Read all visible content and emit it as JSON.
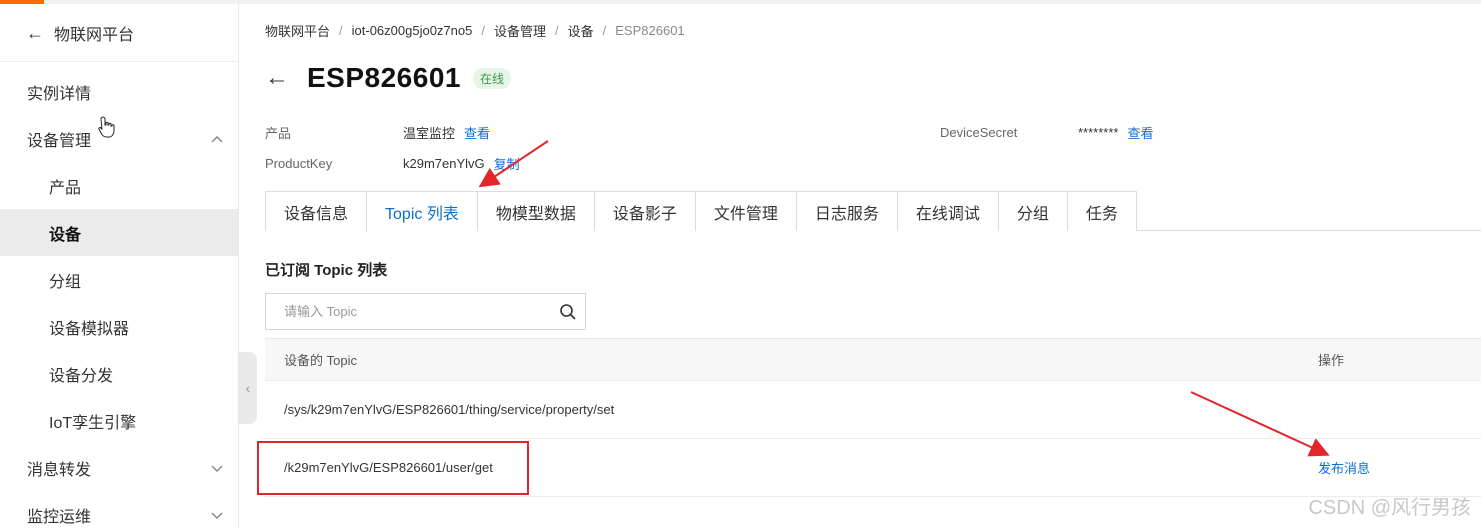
{
  "sidebar": {
    "back_label": "物联网平台",
    "items": [
      {
        "label": "实例详情"
      },
      {
        "label": "设备管理"
      },
      {
        "label": "产品"
      },
      {
        "label": "设备"
      },
      {
        "label": "分组"
      },
      {
        "label": "设备模拟器"
      },
      {
        "label": "设备分发"
      },
      {
        "label": "IoT孪生引擎"
      },
      {
        "label": "消息转发"
      },
      {
        "label": "监控运维"
      }
    ]
  },
  "breadcrumb": [
    "物联网平台",
    "iot-06z00g5jo0z7no5",
    "设备管理",
    "设备",
    "ESP826601"
  ],
  "header": {
    "title": "ESP826601",
    "status": "在线"
  },
  "info": {
    "product_label": "产品",
    "product_value": "温室监控",
    "product_link": "查看",
    "productkey_label": "ProductKey",
    "productkey_value": "k29m7enYlvG",
    "productkey_link": "复制",
    "secret_label": "DeviceSecret",
    "secret_value": "********",
    "secret_link": "查看"
  },
  "tabs": [
    "设备信息",
    "Topic 列表",
    "物模型数据",
    "设备影子",
    "文件管理",
    "日志服务",
    "在线调试",
    "分组",
    "任务"
  ],
  "section_title": "已订阅 Topic 列表",
  "search": {
    "placeholder": "请输入 Topic",
    "value": ""
  },
  "table": {
    "headers": [
      "设备的 Topic",
      "操作"
    ],
    "rows": [
      {
        "topic": "/sys/k29m7enYlvG/ESP826601/thing/service/property/set",
        "action": ""
      },
      {
        "topic": "/k29m7enYlvG/ESP826601/user/get",
        "action": "发布消息"
      }
    ]
  },
  "watermark": "CSDN @风行男孩",
  "colors": {
    "accent": "#ff6a00",
    "link": "#0b6fd3",
    "online": "#3a9a4a",
    "annotation": "#e3242b"
  }
}
